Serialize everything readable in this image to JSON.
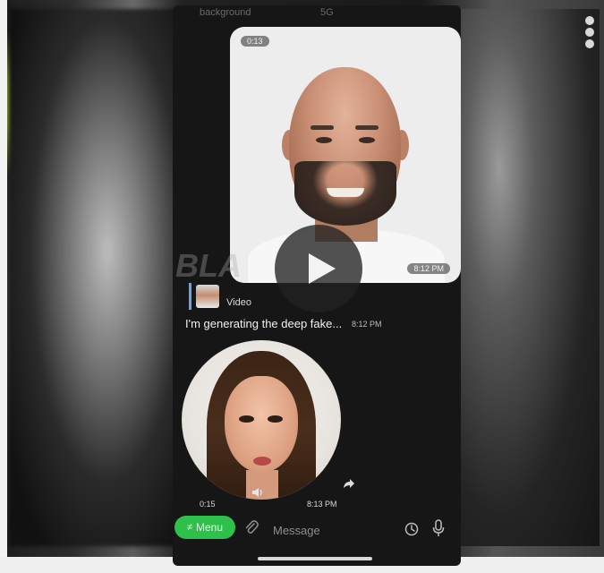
{
  "header": {
    "background_label": "background",
    "signal_text": "5G"
  },
  "video_message": {
    "duration": "0:13",
    "time": "8:12 PM",
    "watermark": "BLA"
  },
  "reply": {
    "label": "Video"
  },
  "text_message": {
    "text": "I'm generating the deep fake...",
    "time": "8:12 PM"
  },
  "round_video_message": {
    "duration": "0:15",
    "time": "8:13 PM"
  },
  "input_bar": {
    "menu_label": "Menu",
    "menu_icon": "slash-command-icon",
    "placeholder": "Message",
    "attach_icon": "paperclip-icon",
    "schedule_icon": "clock-icon",
    "mic_icon": "microphone-icon"
  },
  "colors": {
    "menu_button": "#2fbf4b",
    "reply_bar": "#6aa3e8",
    "chat_background": "#161616"
  }
}
